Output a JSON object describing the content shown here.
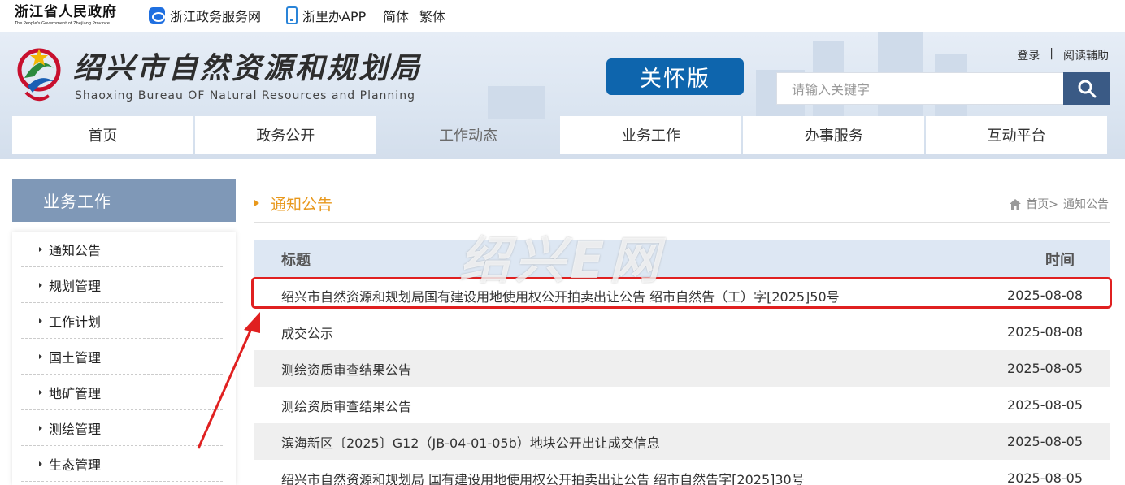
{
  "topbar": {
    "gov_name": "浙江省人民政府",
    "gov_name_en": "The People's Government of Zhejiang Province",
    "link_zwfw": "浙江政务服务网",
    "link_app": "浙里办APP",
    "link_simplified": "简体",
    "link_traditional": "繁体"
  },
  "header": {
    "title": "绍兴市自然资源和规划局",
    "subtitle": "Shaoxing Bureau OF Natural Resources and Planning",
    "care_button": "关怀版",
    "login": "登录",
    "separator": "|",
    "reading_aid": "阅读辅助",
    "search_placeholder": "请输入关键字",
    "search_icon": "search-icon"
  },
  "nav": {
    "items": [
      {
        "label": "首页"
      },
      {
        "label": "政务公开"
      },
      {
        "label": "工作动态"
      },
      {
        "label": "业务工作"
      },
      {
        "label": "办事服务"
      },
      {
        "label": "互动平台"
      }
    ],
    "active_index": 2
  },
  "sidebar": {
    "heading": "业务工作",
    "items": [
      {
        "label": "通知公告"
      },
      {
        "label": "规划管理"
      },
      {
        "label": "工作计划"
      },
      {
        "label": "国土管理"
      },
      {
        "label": "地矿管理"
      },
      {
        "label": "测绘管理"
      },
      {
        "label": "生态管理"
      }
    ]
  },
  "main": {
    "section_title": "通知公告",
    "breadcrumb_home": "首页>",
    "breadcrumb_current": "通知公告",
    "col_title": "标题",
    "col_time": "时间",
    "rows": [
      {
        "title": "绍兴市自然资源和规划局国有建设用地使用权公开拍卖出让公告 绍市自然告（工）字[2025]50号",
        "date": "2025-08-08"
      },
      {
        "title": "成交公示",
        "date": "2025-08-08"
      },
      {
        "title": "测绘资质审查结果公告",
        "date": "2025-08-05"
      },
      {
        "title": "测绘资质审查结果公告",
        "date": "2025-08-05"
      },
      {
        "title": "滨海新区〔2025〕G12（JB-04-01-05b）地块公开出让成交信息",
        "date": "2025-08-05"
      },
      {
        "title": "绍兴市自然资源和规划局 国有建设用地使用权公开拍卖出让公告 绍市自然告字[2025]30号",
        "date": "2025-08-05"
      }
    ]
  },
  "watermark": "绍兴E网",
  "colors": {
    "accent_orange": "#e8981c",
    "care_blue": "#0e65ad",
    "sidebar_head": "#7f98b7",
    "table_head": "#dde7f3",
    "annotation_red": "#e02020"
  }
}
